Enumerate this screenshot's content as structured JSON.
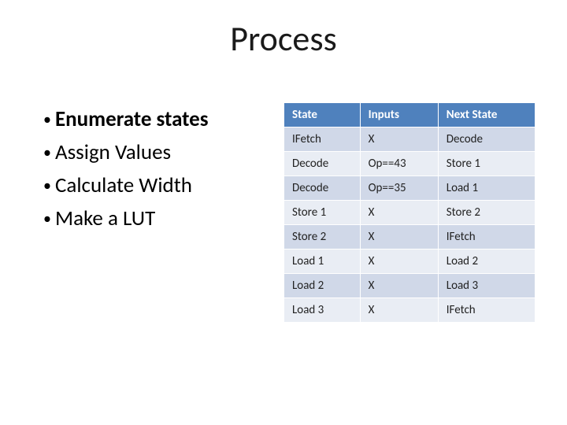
{
  "title": "Process",
  "bullets": [
    {
      "text": "Enumerate states",
      "bold": true
    },
    {
      "text": "Assign Values",
      "bold": false
    },
    {
      "text": "Calculate Width",
      "bold": false
    },
    {
      "text": "Make a LUT",
      "bold": false
    }
  ],
  "table": {
    "headers": [
      "State",
      "Inputs",
      "Next State"
    ],
    "rows": [
      [
        "IFetch",
        "X",
        "Decode"
      ],
      [
        "Decode",
        "Op==43",
        "Store 1"
      ],
      [
        "Decode",
        "Op==35",
        "Load 1"
      ],
      [
        "Store 1",
        "X",
        "Store 2"
      ],
      [
        "Store 2",
        "X",
        "IFetch"
      ],
      [
        "Load 1",
        "X",
        "Load 2"
      ],
      [
        "Load 2",
        "X",
        "Load 3"
      ],
      [
        "Load 3",
        "X",
        "IFetch"
      ]
    ]
  }
}
